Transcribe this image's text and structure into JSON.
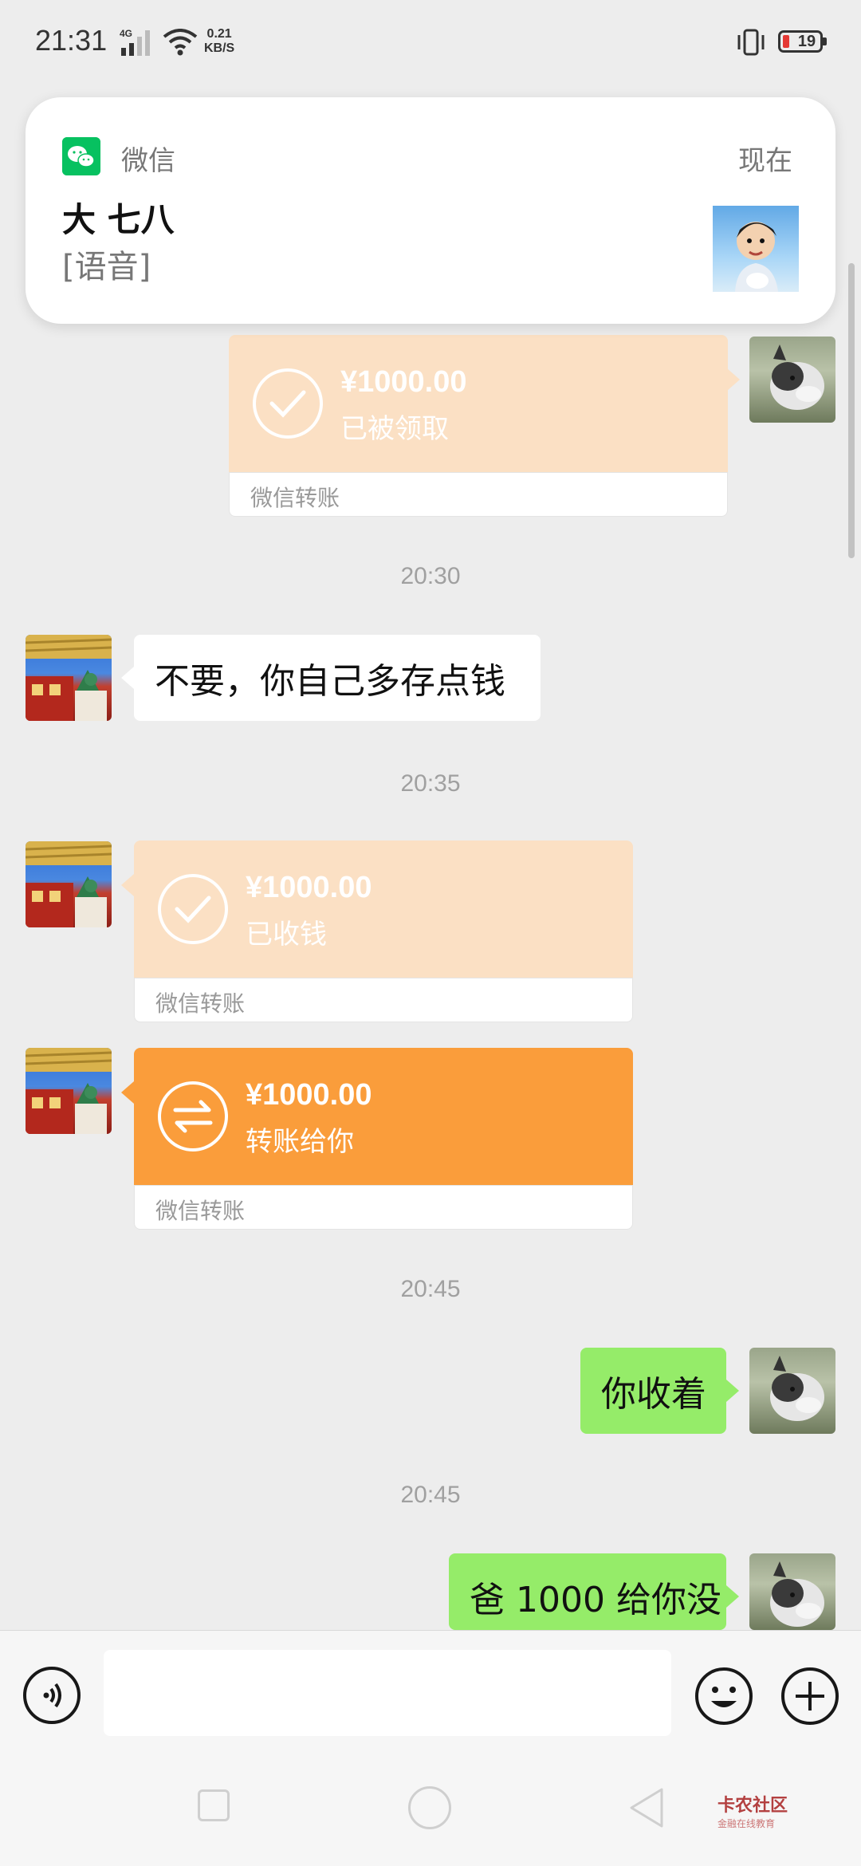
{
  "status_bar": {
    "time": "21:31",
    "network": "4G",
    "speed_value": "0.21",
    "speed_unit": "KB/S",
    "battery": "19"
  },
  "notification": {
    "app_name": "微信",
    "time": "现在",
    "sender": "大 七八",
    "message": "[语音]"
  },
  "messages": {
    "transfer_1": {
      "amount": "¥1000.00",
      "status": "已被领取",
      "label": "微信转账"
    },
    "time_1": "20:30",
    "text_1": "不要，你自己多存点钱",
    "time_2": "20:35",
    "transfer_2": {
      "amount": "¥1000.00",
      "status": "已收钱",
      "label": "微信转账"
    },
    "transfer_3": {
      "amount": "¥1000.00",
      "status": "转账给你",
      "label": "微信转账"
    },
    "time_3": "20:45",
    "text_2": "你收着",
    "time_4": "20:45",
    "text_3": "爸 1000 给你没"
  },
  "watermark": {
    "brand": "卡农社区",
    "tagline": "金融在线教育"
  },
  "colors": {
    "wechat_green": "#07c160",
    "bubble_green": "#95ec69",
    "transfer_orange": "#fa9d3b",
    "transfer_faded": "#fbe0c4"
  },
  "icons": [
    "voice-icon",
    "emoji-icon",
    "plus-icon",
    "check-icon",
    "transfer-arrows-icon",
    "wechat-icon"
  ]
}
